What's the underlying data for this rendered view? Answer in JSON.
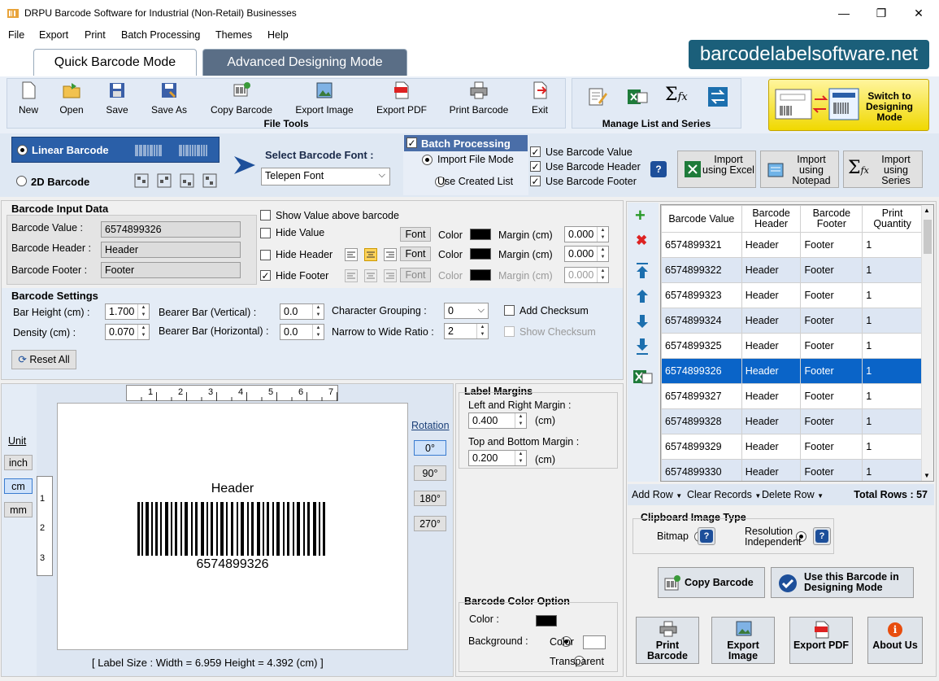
{
  "window": {
    "title": "DRPU Barcode Software for Industrial (Non-Retail) Businesses",
    "minimize": "—",
    "maximize": "❐",
    "close": "✕"
  },
  "menu": [
    "File",
    "Export",
    "Print",
    "Batch Processing",
    "Themes",
    "Help"
  ],
  "tabs": {
    "quick": "Quick Barcode Mode",
    "advanced": "Advanced Designing Mode"
  },
  "brand": "barcodelabelsoftware.net",
  "toolbar": {
    "file_tools": [
      "New",
      "Open",
      "Save",
      "Save As",
      "Copy Barcode",
      "Export Image",
      "Export PDF",
      "Print Barcode",
      "Exit"
    ],
    "file_tools_title": "File Tools",
    "manage_title": "Manage List and Series",
    "switch_label": "Switch to Designing Mode"
  },
  "barcode_type": {
    "linear": "Linear Barcode",
    "twod": "2D Barcode"
  },
  "font_select": {
    "label": "Select Barcode Font :",
    "value": "Telepen Font"
  },
  "batch": {
    "title": "Batch Processing",
    "import_file": "Import File Mode",
    "use_created": "Use Created List",
    "use_value": "Use Barcode Value",
    "use_header": "Use Barcode Header",
    "use_footer": "Use Barcode Footer",
    "help": "?",
    "import_excel": "Import using Excel",
    "import_notepad": "Import using Notepad",
    "import_series": "Import using Series"
  },
  "input": {
    "title": "Barcode Input Data",
    "value_label": "Barcode Value :",
    "value": "6574899326",
    "header_label": "Barcode Header :",
    "header": "Header",
    "footer_label": "Barcode Footer :",
    "footer": "Footer",
    "show_above": "Show Value above barcode",
    "hide_value": "Hide Value",
    "hide_header": "Hide Header",
    "hide_footer": "Hide Footer",
    "font": "Font",
    "color": "Color",
    "margin": "Margin (cm)",
    "margin_value": "0.000"
  },
  "settings": {
    "title": "Barcode Settings",
    "bar_height_label": "Bar Height (cm) :",
    "bar_height": "1.700",
    "density_label": "Density (cm) :",
    "density": "0.070",
    "bearer_v_label": "Bearer Bar (Vertical) :",
    "bearer_v": "0.0",
    "bearer_h_label": "Bearer Bar (Horizontal) :",
    "bearer_h": "0.0",
    "char_group_label": "Character Grouping :",
    "char_group": "0",
    "narrow_label": "Narrow to Wide Ratio :",
    "narrow": "2",
    "add_checksum": "Add Checksum",
    "show_checksum": "Show Checksum",
    "reset": "Reset All"
  },
  "preview": {
    "unit_title": "Unit",
    "units": [
      "inch",
      "cm",
      "mm"
    ],
    "ruler_h": [
      "1",
      "2",
      "3",
      "4",
      "5",
      "6",
      "7"
    ],
    "ruler_v": [
      "1",
      "2",
      "3"
    ],
    "header": "Header",
    "value": "6574899326",
    "rotation_title": "Rotation",
    "rotations": [
      "0°",
      "90°",
      "180°",
      "270°"
    ],
    "label_size": "[ Label Size : Width = 6.959  Height = 4.392 (cm) ]"
  },
  "margins": {
    "title": "Label Margins",
    "lr_label": "Left and Right Margin :",
    "lr": "0.400",
    "tb_label": "Top and Bottom Margin :",
    "tb": "0.200",
    "unit": "(cm)"
  },
  "color_option": {
    "title": "Barcode Color Option",
    "color_label": "Color :",
    "bg_label": "Background :",
    "color": "Color",
    "transparent": "Transparent"
  },
  "table": {
    "headers": [
      "Barcode Value",
      "Barcode Header",
      "Barcode Footer",
      "Print Quantity"
    ],
    "rows": [
      [
        "6574899321",
        "Header",
        "Footer",
        "1"
      ],
      [
        "6574899322",
        "Header",
        "Footer",
        "1"
      ],
      [
        "6574899323",
        "Header",
        "Footer",
        "1"
      ],
      [
        "6574899324",
        "Header",
        "Footer",
        "1"
      ],
      [
        "6574899325",
        "Header",
        "Footer",
        "1"
      ],
      [
        "6574899326",
        "Header",
        "Footer",
        "1"
      ],
      [
        "6574899327",
        "Header",
        "Footer",
        "1"
      ],
      [
        "6574899328",
        "Header",
        "Footer",
        "1"
      ],
      [
        "6574899329",
        "Header",
        "Footer",
        "1"
      ],
      [
        "6574899330",
        "Header",
        "Footer",
        "1"
      ]
    ],
    "selected_index": 5,
    "add_row": "Add Row",
    "clear_records": "Clear Records",
    "delete_row": "Delete Row",
    "total_rows": "Total Rows : 57"
  },
  "clipboard": {
    "title": "Clipboard Image Type",
    "bitmap": "Bitmap",
    "resolution": "Resolution Independent",
    "help": "?"
  },
  "actions": {
    "copy": "Copy Barcode",
    "use_design": "Use this Barcode in Designing Mode",
    "print": "Print Barcode",
    "export_image": "Export Image",
    "export_pdf": "Export PDF",
    "about": "About Us"
  },
  "colors": {
    "accent": "#1b5f7a",
    "selection": "#0a64c8",
    "batch_header": "#4a6ea8"
  }
}
